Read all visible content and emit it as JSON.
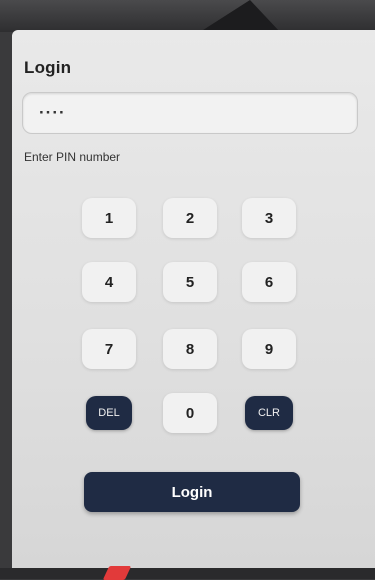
{
  "login": {
    "title": "Login",
    "pin_value": "····",
    "hint": "Enter PIN number",
    "keys": {
      "k1": "1",
      "k2": "2",
      "k3": "3",
      "k4": "4",
      "k5": "5",
      "k6": "6",
      "k7": "7",
      "k8": "8",
      "k9": "9",
      "del": "DEL",
      "k0": "0",
      "clr": "CLR"
    },
    "submit_label": "Login"
  },
  "colors": {
    "dark_button": "#1f2b44",
    "key_background": "#f1f1f1",
    "panel_background": "#e4e4e4"
  }
}
